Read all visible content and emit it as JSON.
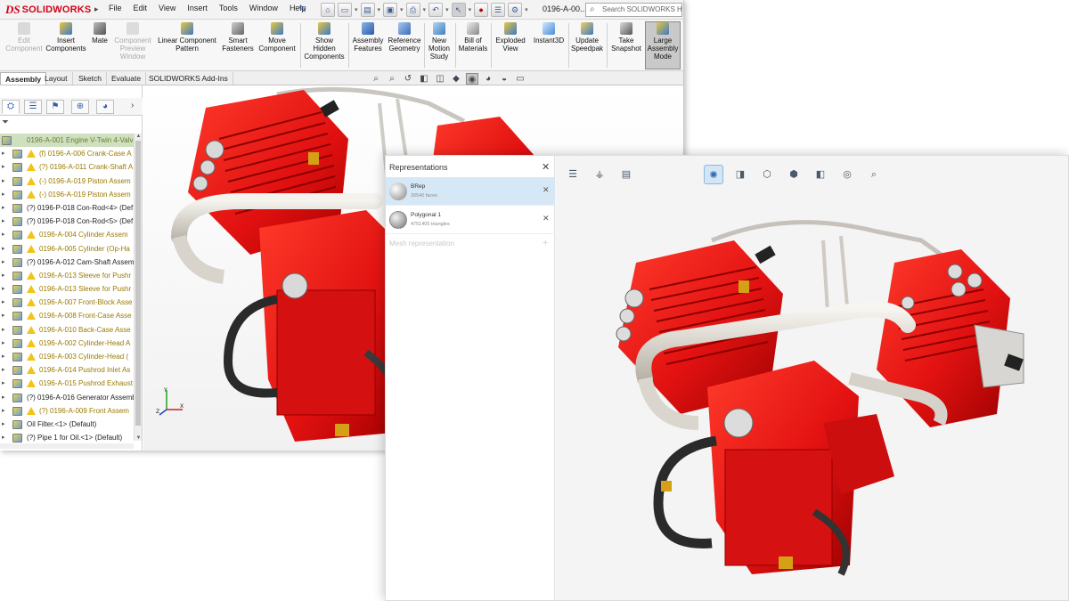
{
  "solidworks": {
    "logo": {
      "ds": "DS",
      "name": "SOLIDWORKS"
    },
    "menus": [
      "File",
      "Edit",
      "View",
      "Insert",
      "Tools",
      "Window",
      "Help"
    ],
    "file_name": "0196-A-00...",
    "search_placeholder": "Search SOLIDWORKS Help",
    "ribbon": {
      "edit_component": "Edit\nComponent",
      "insert_components": "Insert\nComponents",
      "mate": "Mate",
      "component_preview": "Component\nPreview\nWindow",
      "linear_pattern": "Linear Component\nPattern",
      "smart_fasteners": "Smart\nFasteners",
      "move_component": "Move\nComponent",
      "show_hidden": "Show\nHidden\nComponents",
      "assembly_features": "Assembly\nFeatures",
      "reference_geometry": "Reference\nGeometry",
      "new_motion_study": "New\nMotion\nStudy",
      "bill_of_materials": "Bill of\nMaterials",
      "exploded_view": "Exploded\nView",
      "instant3d": "Instant3D",
      "update_speedpak": "Update\nSpeedpak",
      "take_snapshot": "Take\nSnapshot",
      "large_assembly_mode": "Large\nAssembly\nMode"
    },
    "tabs": [
      "Assembly",
      "Layout",
      "Sketch",
      "Evaluate",
      "SOLIDWORKS Add-Ins"
    ],
    "tree": [
      {
        "label": "0196-A-001 Engine V-Twin 4-Valv",
        "warn": false,
        "top": true
      },
      {
        "label": "(f) 0196-A-006 Crank-Case A",
        "warn": true
      },
      {
        "label": "(?) 0196-A-011 Crank-Shaft A",
        "warn": true
      },
      {
        "label": "(-) 0196-A-019 Piston Assem",
        "warn": true
      },
      {
        "label": "(-) 0196-A-019 Piston Assem",
        "warn": true
      },
      {
        "label": "(?) 0196-P-018 Con-Rod<4> (Def",
        "warn": false
      },
      {
        "label": "(?) 0196-P-018 Con-Rod<5> (Def",
        "warn": false
      },
      {
        "label": "0196-A-004 Cylinder Assem",
        "warn": true
      },
      {
        "label": "0196-A-005 Cylinder (Op-Ha",
        "warn": true
      },
      {
        "label": "(?) 0196-A-012 Cam-Shaft Assem",
        "warn": false
      },
      {
        "label": "0196-A-013 Sleeve for Pushr",
        "warn": true
      },
      {
        "label": "0196-A-013 Sleeve for Pushr",
        "warn": true
      },
      {
        "label": "0196-A-007 Front-Block Asse",
        "warn": true
      },
      {
        "label": "0196-A-008 Front-Case Asse",
        "warn": true
      },
      {
        "label": "0196-A-010 Back-Case Asse",
        "warn": true
      },
      {
        "label": "0196-A-002 Cylinder-Head A",
        "warn": true
      },
      {
        "label": "0196-A-003 Cylinder-Head (",
        "warn": true
      },
      {
        "label": "0196-A-014 Pushrod Inlet As",
        "warn": true
      },
      {
        "label": "0196-A-015 Pushrod Exhaust",
        "warn": true
      },
      {
        "label": "(?) 0196-A-016 Generator Assemb",
        "warn": false
      },
      {
        "label": "(?) 0196-A-009 Front Assem",
        "warn": true
      },
      {
        "label": "Oil Filter.<1> (Default)",
        "warn": false
      },
      {
        "label": "(?) Pipe 1 for Oil.<1> (Default)",
        "warn": false
      }
    ]
  },
  "viewer": {
    "panel_title": "Representations",
    "representations": [
      {
        "name": "BRep",
        "sub": "30540 faces",
        "selected": true
      },
      {
        "name": "Polygonal 1",
        "sub": "4751405 triangles",
        "selected": false
      }
    ],
    "mesh_representation": "Mesh representation"
  },
  "colors": {
    "engine_red": "#e01010",
    "sw_brand": "#d0021b",
    "selection_blue": "#d6e8f6"
  }
}
